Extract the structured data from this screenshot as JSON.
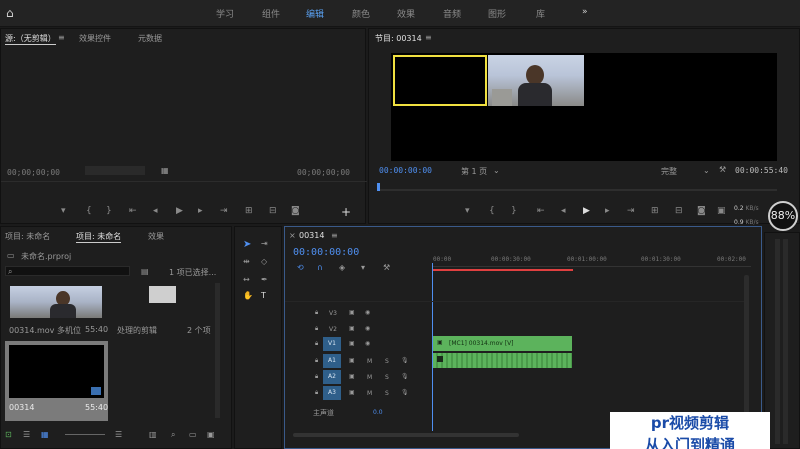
{
  "nav": {
    "items": [
      "学习",
      "组件",
      "编辑",
      "颜色",
      "效果",
      "音频",
      "图形",
      "库"
    ],
    "active_index": 2,
    "more": "»"
  },
  "source_panel": {
    "tabs": [
      "源:（无剪辑）",
      "效果控件",
      "元数据"
    ],
    "menu_icon": "≡",
    "timecode_left": "00;00;00;00",
    "timecode_right": "00;00;00;00"
  },
  "program_panel": {
    "title": "节目: 00314",
    "menu_icon": "≡",
    "timecode": "00:00:00:00",
    "page_select": "第 1 页",
    "fit_select": "完整",
    "duration": "00:00:55:40",
    "meter_values": [
      "0.2",
      "0.9"
    ],
    "meter_units": [
      "KB/s",
      "KB/s"
    ],
    "zoom_badge": "88%"
  },
  "project_panel": {
    "tabs": [
      "项目: 未命名",
      "项目: 未命名",
      "效果"
    ],
    "file_name": "未命名.prproj",
    "selected_count": "1 项已选择...",
    "items": [
      {
        "name": "00314.mov 多机位",
        "duration": "55:40",
        "type": "thumbnail-video"
      },
      {
        "name": "处理的剪辑",
        "count": "2 个项",
        "type": "bin"
      },
      {
        "name": "00314",
        "duration": "55:40",
        "type": "sequence"
      }
    ]
  },
  "timeline": {
    "title": "00314",
    "menu_icon": "≡",
    "timecode": "00:00:00:00",
    "ruler": [
      "00:00",
      "00:00:30:00",
      "00:01:00:00",
      "00:01:30:00",
      "00:02:00"
    ],
    "video_tracks": [
      "V3",
      "V2",
      "V1"
    ],
    "audio_tracks": [
      "A1",
      "A2",
      "A3"
    ],
    "master_label": "主声道",
    "master_value": "0.0",
    "video_clip_label": "[MC1] 00314.mov [V]",
    "audio_m": "M",
    "audio_s": "S"
  },
  "watermark": {
    "line1": "pr视频剪辑",
    "line2": "从入门到精通"
  },
  "colors": {
    "accent_blue": "#4f8ff0",
    "clip_green": "#5cb35c",
    "highlight_yellow": "#f0e040",
    "playhead_red": "#e04040"
  }
}
